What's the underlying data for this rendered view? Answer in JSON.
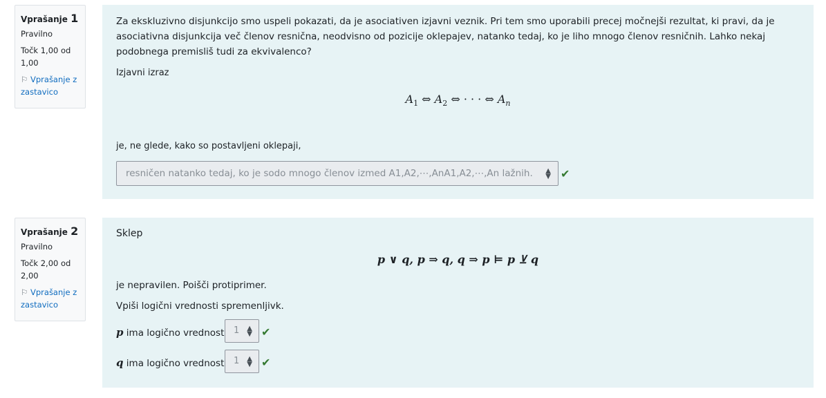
{
  "q1": {
    "label": "Vprašanje",
    "number": "1",
    "state": "Pravilno",
    "grade_line1": "Točk 1,00 od",
    "grade_line2": "1,00",
    "flag_line1": "Vprašanje z",
    "flag_line2": "zastavico",
    "text_line1": "Za ekskluzivno disjunkcijo smo uspeli pokazati, da je asociativen izjavni veznik. Pri tem smo uporabili precej močnejši rezultat, ki pravi, da je",
    "text_line2": "asociativna disjunkcija več členov resnična, neodvisno od pozicije oklepajev, natanko tedaj, ko je liho mnogo členov resničnih. Lahko nekaj",
    "text_line3": "podobnega premisliš tudi za ekvivalenco?",
    "expr_label": "Izjavni izraz",
    "formula": {
      "a1": "A",
      "s1": "1",
      "a2": "A",
      "s2": "2",
      "dots": "· · ·",
      "an": "A",
      "sn": "n",
      "op": "⇔"
    },
    "after_formula": "je, ne glede, kako so postavljeni oklepaji,",
    "select_value": "resničen natanko tedaj, ko je sodo mnogo členov izmed A1,A2,⋯,AnA1,A2,⋯,An lažnih.",
    "status_color": "#357a32"
  },
  "q2": {
    "label": "Vprašanje",
    "number": "2",
    "state": "Pravilno",
    "grade_line1": "Točk 2,00 od",
    "grade_line2": "2,00",
    "flag_line1": "Vprašanje z",
    "flag_line2": "zastavico",
    "intro": "Sklep",
    "formula": "p ∨ q, p ⇒ q, q ⇒ p ⊨ p ⊻ q",
    "line1": "je nepravilen. Poišči protiprimer.",
    "line2": "Vpiši logični vrednosti spremenljivk.",
    "p_var": "p",
    "q_var": "q",
    "value_label": "ima logično vrednost",
    "p_value": "1",
    "q_value": "1"
  },
  "icons": {
    "check": "check-icon",
    "flag": "flag-icon",
    "caret": "up-down-caret-icon"
  },
  "colors": {
    "content_bg": "#e7f3f5",
    "info_bg": "#f8f9fa",
    "link": "#0f6cbf",
    "correct": "#357a32"
  }
}
